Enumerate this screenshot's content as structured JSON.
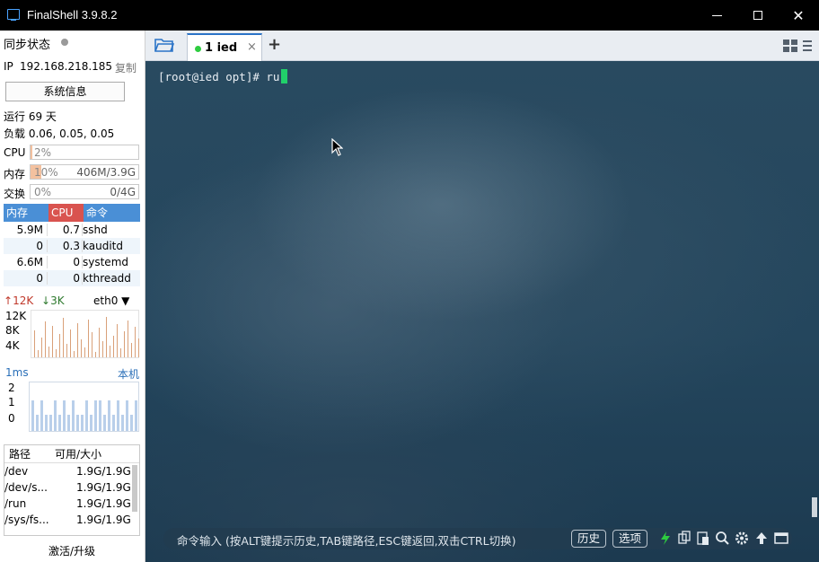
{
  "window": {
    "title": "FinalShell 3.9.8.2",
    "min_label": "—",
    "max_label": "☐",
    "close_label": "✕"
  },
  "sidebar": {
    "sync_label": "同步状态",
    "ip_label": "IP",
    "ip_value": "192.168.218.185",
    "copy_label": "复制",
    "sysinfo_button": "系统信息",
    "uptime": "运行 69 天",
    "load": "负载 0.06, 0.05, 0.05",
    "meters": [
      {
        "label": "CPU",
        "pct_text": "2%",
        "amount": "",
        "fill": 0.02
      },
      {
        "label": "内存",
        "pct_text": "10%",
        "amount": "406M/3.9G",
        "fill": 0.1
      },
      {
        "label": "交换",
        "pct_text": "0%",
        "amount": "0/4G",
        "fill": 0.0
      }
    ],
    "proc_headers": {
      "mem": "内存",
      "cpu": "CPU",
      "cmd": "命令"
    },
    "processes": [
      {
        "mem": "5.9M",
        "cpu": "0.7",
        "cmd": "sshd"
      },
      {
        "mem": "0",
        "cpu": "0.3",
        "cmd": "kauditd"
      },
      {
        "mem": "6.6M",
        "cpu": "0",
        "cmd": "systemd"
      },
      {
        "mem": "0",
        "cpu": "0",
        "cmd": "kthreadd"
      }
    ],
    "net": {
      "up": "12K",
      "down": "3K",
      "iface": "eth0",
      "scale": [
        "12K",
        "8K",
        "4K"
      ]
    },
    "ping": {
      "latency": "1ms",
      "target": "本机",
      "scale": [
        "2",
        "1",
        "0"
      ]
    },
    "fs_headers": {
      "path": "路径",
      "size": "可用/大小"
    },
    "filesystems": [
      {
        "path": "/dev",
        "size": "1.9G/1.9G"
      },
      {
        "path": "/dev/s...",
        "size": "1.9G/1.9G"
      },
      {
        "path": "/run",
        "size": "1.9G/1.9G"
      },
      {
        "path": "/sys/fs...",
        "size": "1.9G/1.9G"
      }
    ],
    "activate_label": "激活/升级"
  },
  "tabs": [
    {
      "label": "1 ied",
      "active": true
    }
  ],
  "terminal": {
    "prompt": "[root@ied opt]# ru",
    "cursor_color": "#21d06a"
  },
  "cmdbar": {
    "hint": "命令输入 (按ALT键提示历史,TAB键路径,ESC键返回,双击CTRL切换)",
    "history_button": "历史",
    "options_button": "选项",
    "icons": [
      "lightning-icon",
      "copy-icon",
      "paste-icon",
      "search-icon",
      "gear-icon",
      "arrow-up-icon",
      "window-icon"
    ]
  },
  "colors": {
    "accent": "#2b74c7",
    "cpu_header": "#d9534f",
    "mem_header": "#4a8fd6",
    "up_arrow": "#c0392b",
    "down_arrow": "#2f7a2f"
  }
}
